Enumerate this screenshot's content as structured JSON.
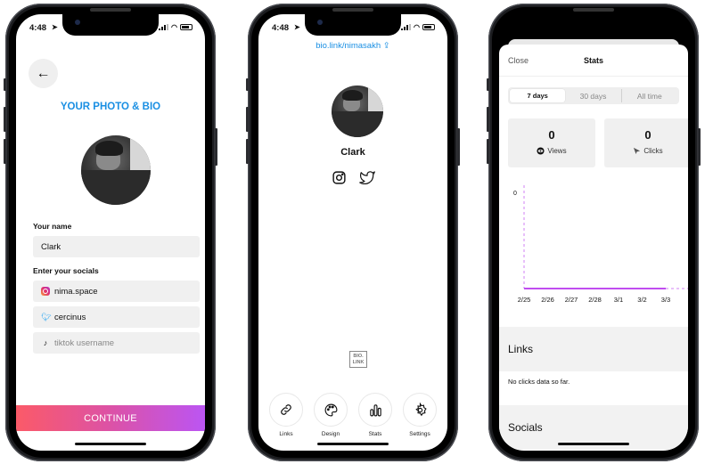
{
  "status_bar": {
    "time": "4:48"
  },
  "phone1": {
    "back_icon": "arrow-left-icon",
    "title": "YOUR PHOTO & BIO",
    "name_label": "Your name",
    "name_value": "Clark",
    "socials_label": "Enter your socials",
    "socials": [
      {
        "icon": "instagram-icon",
        "value": "nima.space",
        "placeholder": ""
      },
      {
        "icon": "twitter-icon",
        "value": "cercinus",
        "placeholder": ""
      },
      {
        "icon": "tiktok-icon",
        "value": "",
        "placeholder": "tiktok username"
      }
    ],
    "continue_label": "CONTINUE"
  },
  "phone2": {
    "url": "bio.link/nimasakh",
    "share_icon": "share-icon",
    "profile_name": "Clark",
    "social_icons": [
      "instagram-icon",
      "twitter-icon"
    ],
    "logo_text": [
      "BIO.",
      "LINK"
    ],
    "tabs": [
      {
        "label": "Links",
        "icon": "link-icon"
      },
      {
        "label": "Design",
        "icon": "palette-icon"
      },
      {
        "label": "Stats",
        "icon": "bar-chart-icon"
      },
      {
        "label": "Settings",
        "icon": "gear-icon"
      }
    ]
  },
  "phone3": {
    "close_label": "Close",
    "title": "Stats",
    "ranges": [
      {
        "label": "7 days",
        "active": true
      },
      {
        "label": "30 days",
        "active": false
      },
      {
        "label": "All time",
        "active": false
      }
    ],
    "cards": [
      {
        "value": "0",
        "label": "Views",
        "icon": "eye-icon"
      },
      {
        "value": "0",
        "label": "Clicks",
        "icon": "cursor-icon"
      }
    ],
    "links_heading": "Links",
    "no_data_text": "No clicks data so far.",
    "socials_heading": "Socials",
    "accent_color": "#c04df0"
  },
  "chart_data": {
    "type": "line",
    "title": "",
    "xlabel": "",
    "ylabel": "",
    "categories": [
      "2/25",
      "2/26",
      "2/27",
      "2/28",
      "3/1",
      "3/2",
      "3/3"
    ],
    "series": [
      {
        "name": "Views",
        "values": [
          0,
          0,
          0,
          0,
          0,
          0,
          0
        ]
      }
    ],
    "y_ticks": [
      "0"
    ],
    "ylim": [
      0,
      0
    ],
    "grid": false,
    "legend": "none"
  }
}
